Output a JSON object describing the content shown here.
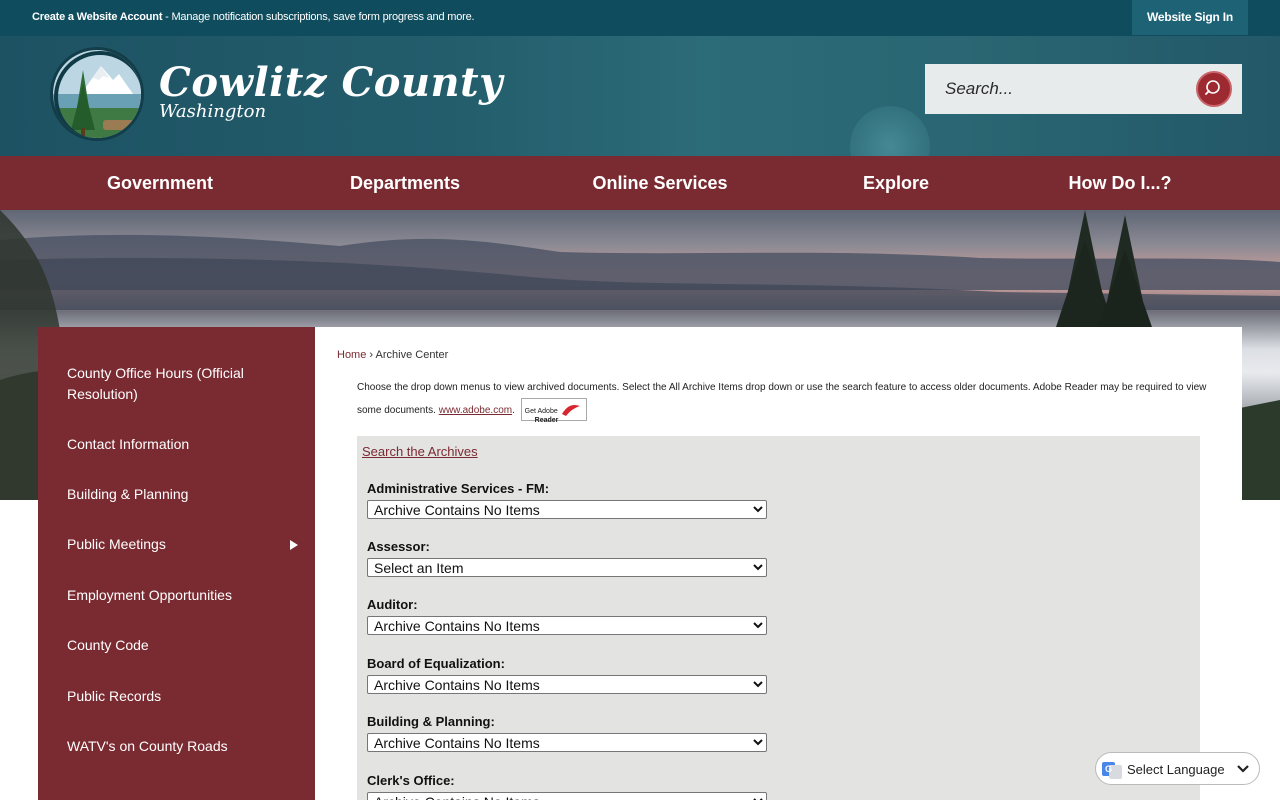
{
  "topbar": {
    "account_link": "Create a Website Account",
    "account_desc": " - Manage notification subscriptions, save form progress and more.",
    "signin": "Website Sign In"
  },
  "header": {
    "title": "Cowlitz County",
    "subtitle": "Washington",
    "search_placeholder": "Search..."
  },
  "nav": {
    "items": [
      "Government",
      "Departments",
      "Online Services",
      "Explore",
      "How Do I...?"
    ]
  },
  "sidebar": {
    "items": [
      "County Office Hours (Official Resolution)",
      "Contact Information",
      "Building & Planning",
      "Public Meetings",
      "Employment Opportunities",
      "County Code",
      "Public Records",
      "WATV's on County Roads"
    ]
  },
  "breadcrumb": {
    "home": "Home",
    "separator": " › ",
    "current": "Archive Center"
  },
  "intro": {
    "text": "Choose the drop down menus to view archived documents. Select the All Archive Items drop down or use the search feature to access older documents. Adobe Reader may be required to view some documents. ",
    "link": "www.adobe.com",
    "after_link": ".",
    "badge_line1": "Get Adobe",
    "badge_line2": "Reader"
  },
  "archive": {
    "search_link": "Search the Archives",
    "groups": [
      {
        "label": "Administrative Services - FM:",
        "selected": "Archive Contains No Items"
      },
      {
        "label": "Assessor:",
        "selected": "Select an Item"
      },
      {
        "label": "Auditor:",
        "selected": "Archive Contains No Items"
      },
      {
        "label": "Board of Equalization:",
        "selected": "Archive Contains No Items"
      },
      {
        "label": "Building & Planning:",
        "selected": "Archive Contains No Items"
      },
      {
        "label": "Clerk's Office:",
        "selected": "Archive Contains No Items"
      }
    ]
  },
  "translate": {
    "label": "Select Language"
  },
  "colors": {
    "topbar": "#0f4d5e",
    "nav": "#7a2a31",
    "accent": "#9e2a31",
    "archive_bg": "#e3e3e1"
  }
}
